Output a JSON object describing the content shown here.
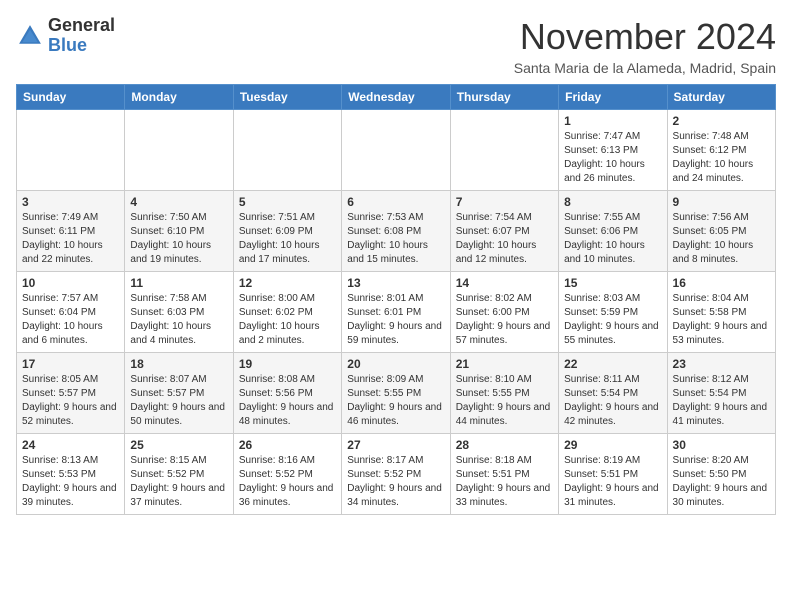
{
  "header": {
    "logo_general": "General",
    "logo_blue": "Blue",
    "month_title": "November 2024",
    "location": "Santa Maria de la Alameda, Madrid, Spain"
  },
  "weekdays": [
    "Sunday",
    "Monday",
    "Tuesday",
    "Wednesday",
    "Thursday",
    "Friday",
    "Saturday"
  ],
  "weeks": [
    [
      {
        "day": "",
        "sunrise": "",
        "sunset": "",
        "daylight": ""
      },
      {
        "day": "",
        "sunrise": "",
        "sunset": "",
        "daylight": ""
      },
      {
        "day": "",
        "sunrise": "",
        "sunset": "",
        "daylight": ""
      },
      {
        "day": "",
        "sunrise": "",
        "sunset": "",
        "daylight": ""
      },
      {
        "day": "",
        "sunrise": "",
        "sunset": "",
        "daylight": ""
      },
      {
        "day": "1",
        "sunrise": "Sunrise: 7:47 AM",
        "sunset": "Sunset: 6:13 PM",
        "daylight": "Daylight: 10 hours and 26 minutes."
      },
      {
        "day": "2",
        "sunrise": "Sunrise: 7:48 AM",
        "sunset": "Sunset: 6:12 PM",
        "daylight": "Daylight: 10 hours and 24 minutes."
      }
    ],
    [
      {
        "day": "3",
        "sunrise": "Sunrise: 7:49 AM",
        "sunset": "Sunset: 6:11 PM",
        "daylight": "Daylight: 10 hours and 22 minutes."
      },
      {
        "day": "4",
        "sunrise": "Sunrise: 7:50 AM",
        "sunset": "Sunset: 6:10 PM",
        "daylight": "Daylight: 10 hours and 19 minutes."
      },
      {
        "day": "5",
        "sunrise": "Sunrise: 7:51 AM",
        "sunset": "Sunset: 6:09 PM",
        "daylight": "Daylight: 10 hours and 17 minutes."
      },
      {
        "day": "6",
        "sunrise": "Sunrise: 7:53 AM",
        "sunset": "Sunset: 6:08 PM",
        "daylight": "Daylight: 10 hours and 15 minutes."
      },
      {
        "day": "7",
        "sunrise": "Sunrise: 7:54 AM",
        "sunset": "Sunset: 6:07 PM",
        "daylight": "Daylight: 10 hours and 12 minutes."
      },
      {
        "day": "8",
        "sunrise": "Sunrise: 7:55 AM",
        "sunset": "Sunset: 6:06 PM",
        "daylight": "Daylight: 10 hours and 10 minutes."
      },
      {
        "day": "9",
        "sunrise": "Sunrise: 7:56 AM",
        "sunset": "Sunset: 6:05 PM",
        "daylight": "Daylight: 10 hours and 8 minutes."
      }
    ],
    [
      {
        "day": "10",
        "sunrise": "Sunrise: 7:57 AM",
        "sunset": "Sunset: 6:04 PM",
        "daylight": "Daylight: 10 hours and 6 minutes."
      },
      {
        "day": "11",
        "sunrise": "Sunrise: 7:58 AM",
        "sunset": "Sunset: 6:03 PM",
        "daylight": "Daylight: 10 hours and 4 minutes."
      },
      {
        "day": "12",
        "sunrise": "Sunrise: 8:00 AM",
        "sunset": "Sunset: 6:02 PM",
        "daylight": "Daylight: 10 hours and 2 minutes."
      },
      {
        "day": "13",
        "sunrise": "Sunrise: 8:01 AM",
        "sunset": "Sunset: 6:01 PM",
        "daylight": "Daylight: 9 hours and 59 minutes."
      },
      {
        "day": "14",
        "sunrise": "Sunrise: 8:02 AM",
        "sunset": "Sunset: 6:00 PM",
        "daylight": "Daylight: 9 hours and 57 minutes."
      },
      {
        "day": "15",
        "sunrise": "Sunrise: 8:03 AM",
        "sunset": "Sunset: 5:59 PM",
        "daylight": "Daylight: 9 hours and 55 minutes."
      },
      {
        "day": "16",
        "sunrise": "Sunrise: 8:04 AM",
        "sunset": "Sunset: 5:58 PM",
        "daylight": "Daylight: 9 hours and 53 minutes."
      }
    ],
    [
      {
        "day": "17",
        "sunrise": "Sunrise: 8:05 AM",
        "sunset": "Sunset: 5:57 PM",
        "daylight": "Daylight: 9 hours and 52 minutes."
      },
      {
        "day": "18",
        "sunrise": "Sunrise: 8:07 AM",
        "sunset": "Sunset: 5:57 PM",
        "daylight": "Daylight: 9 hours and 50 minutes."
      },
      {
        "day": "19",
        "sunrise": "Sunrise: 8:08 AM",
        "sunset": "Sunset: 5:56 PM",
        "daylight": "Daylight: 9 hours and 48 minutes."
      },
      {
        "day": "20",
        "sunrise": "Sunrise: 8:09 AM",
        "sunset": "Sunset: 5:55 PM",
        "daylight": "Daylight: 9 hours and 46 minutes."
      },
      {
        "day": "21",
        "sunrise": "Sunrise: 8:10 AM",
        "sunset": "Sunset: 5:55 PM",
        "daylight": "Daylight: 9 hours and 44 minutes."
      },
      {
        "day": "22",
        "sunrise": "Sunrise: 8:11 AM",
        "sunset": "Sunset: 5:54 PM",
        "daylight": "Daylight: 9 hours and 42 minutes."
      },
      {
        "day": "23",
        "sunrise": "Sunrise: 8:12 AM",
        "sunset": "Sunset: 5:54 PM",
        "daylight": "Daylight: 9 hours and 41 minutes."
      }
    ],
    [
      {
        "day": "24",
        "sunrise": "Sunrise: 8:13 AM",
        "sunset": "Sunset: 5:53 PM",
        "daylight": "Daylight: 9 hours and 39 minutes."
      },
      {
        "day": "25",
        "sunrise": "Sunrise: 8:15 AM",
        "sunset": "Sunset: 5:52 PM",
        "daylight": "Daylight: 9 hours and 37 minutes."
      },
      {
        "day": "26",
        "sunrise": "Sunrise: 8:16 AM",
        "sunset": "Sunset: 5:52 PM",
        "daylight": "Daylight: 9 hours and 36 minutes."
      },
      {
        "day": "27",
        "sunrise": "Sunrise: 8:17 AM",
        "sunset": "Sunset: 5:52 PM",
        "daylight": "Daylight: 9 hours and 34 minutes."
      },
      {
        "day": "28",
        "sunrise": "Sunrise: 8:18 AM",
        "sunset": "Sunset: 5:51 PM",
        "daylight": "Daylight: 9 hours and 33 minutes."
      },
      {
        "day": "29",
        "sunrise": "Sunrise: 8:19 AM",
        "sunset": "Sunset: 5:51 PM",
        "daylight": "Daylight: 9 hours and 31 minutes."
      },
      {
        "day": "30",
        "sunrise": "Sunrise: 8:20 AM",
        "sunset": "Sunset: 5:50 PM",
        "daylight": "Daylight: 9 hours and 30 minutes."
      }
    ]
  ]
}
